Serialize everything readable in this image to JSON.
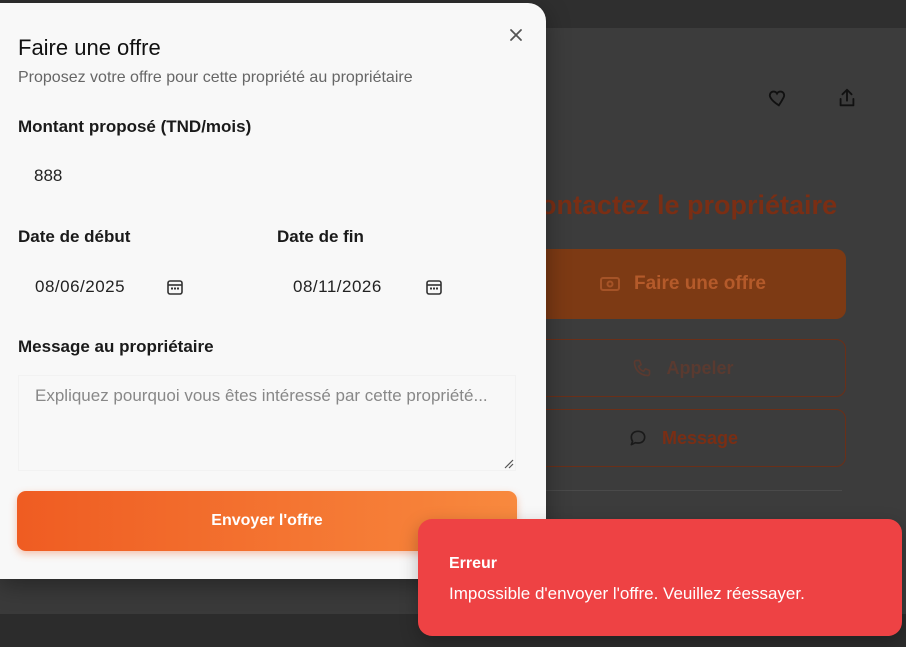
{
  "background": {
    "heading": "ontactez le propriétaire",
    "offer_button": "Faire une offre",
    "call_button": "Appeler",
    "message_button": "Message"
  },
  "modal": {
    "title": "Faire une offre",
    "subtitle": "Proposez votre offre pour cette propriété au propriétaire",
    "amount_label": "Montant proposé (TND/mois)",
    "amount_value": "888",
    "start_date_label": "Date de début",
    "start_date_value": "08/06/2025",
    "end_date_label": "Date de fin",
    "end_date_value": "08/11/2026",
    "message_label": "Message au propriétaire",
    "message_placeholder": "Expliquez pourquoi vous êtes intéressé par cette propriété...",
    "submit_label": "Envoyer l'offre"
  },
  "toast": {
    "title": "Erreur",
    "message": "Impossible d'envoyer l'offre. Veuillez réessayer."
  },
  "colors": {
    "accent": "#ef5c22",
    "accent_light": "#f8893e",
    "error": "#ee4244"
  },
  "icons": {
    "close": "close-icon",
    "favorite": "heart-icon",
    "share": "share-icon",
    "calendar": "calendar-icon",
    "money": "money-icon",
    "phone": "phone-icon",
    "chat": "chat-icon"
  }
}
